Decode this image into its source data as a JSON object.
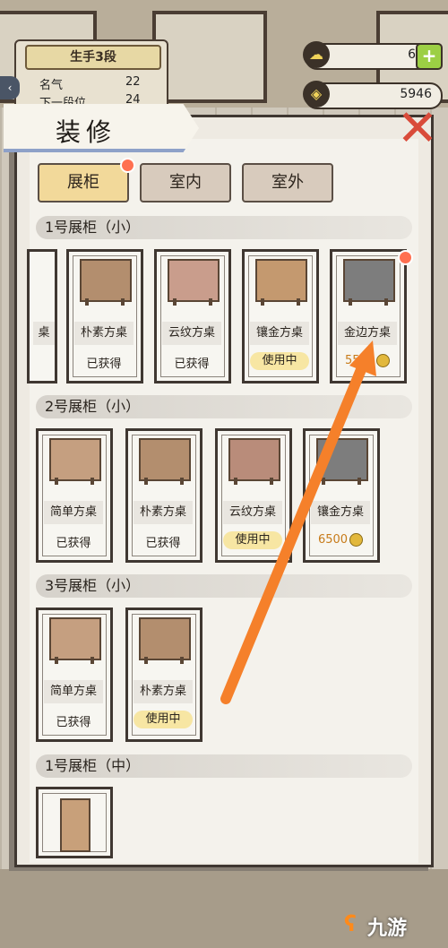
{
  "hud": {
    "rank_title": "生手3段",
    "fame_label": "名气",
    "fame_value": "22",
    "next_label": "下一段位",
    "next_value": "24",
    "gems_value": "6",
    "coins_value": "5946",
    "plus_symbol": "+"
  },
  "panel": {
    "title": "装修",
    "close_symbol": "✕",
    "tabs": [
      {
        "label": "展柜",
        "active": true
      },
      {
        "label": "室内",
        "active": false
      },
      {
        "label": "室外",
        "active": false
      }
    ]
  },
  "sections": [
    {
      "header": "1号展柜（小）",
      "cards": [
        {
          "name": "朴素方桌",
          "status": "已获得",
          "color": "#b38e6e"
        },
        {
          "name": "云纹方桌",
          "status": "已获得",
          "color": "#c99d8c"
        },
        {
          "name": "镶金方桌",
          "status": "使用中",
          "color": "#c4996f"
        },
        {
          "name": "金边方桌",
          "price": "5500",
          "color": "#7d7d7d"
        }
      ],
      "partial_card_text": "桌"
    },
    {
      "header": "2号展柜（小）",
      "cards": [
        {
          "name": "简单方桌",
          "status": "已获得",
          "color": "#c59f80"
        },
        {
          "name": "朴素方桌",
          "status": "已获得",
          "color": "#b38e6e"
        },
        {
          "name": "云纹方桌",
          "status": "使用中",
          "color": "#b98c7a"
        },
        {
          "name": "镶金方桌",
          "price": "6500",
          "color": "#7d7d7d"
        }
      ]
    },
    {
      "header": "3号展柜（小）",
      "cards": [
        {
          "name": "简单方桌",
          "status": "已获得",
          "color": "#c59f80"
        },
        {
          "name": "朴素方桌",
          "status": "使用中",
          "color": "#b38e6e"
        }
      ]
    },
    {
      "header": "1号展柜（中）",
      "cards": [
        {
          "name": "",
          "status": "",
          "color": "#c8a07a"
        }
      ]
    }
  ],
  "watermark": "九游",
  "colors": {
    "arrow": "#f5802a",
    "accent_dot": "#ff7050",
    "coin": "#e2b83c",
    "close": "#d94b3a"
  }
}
